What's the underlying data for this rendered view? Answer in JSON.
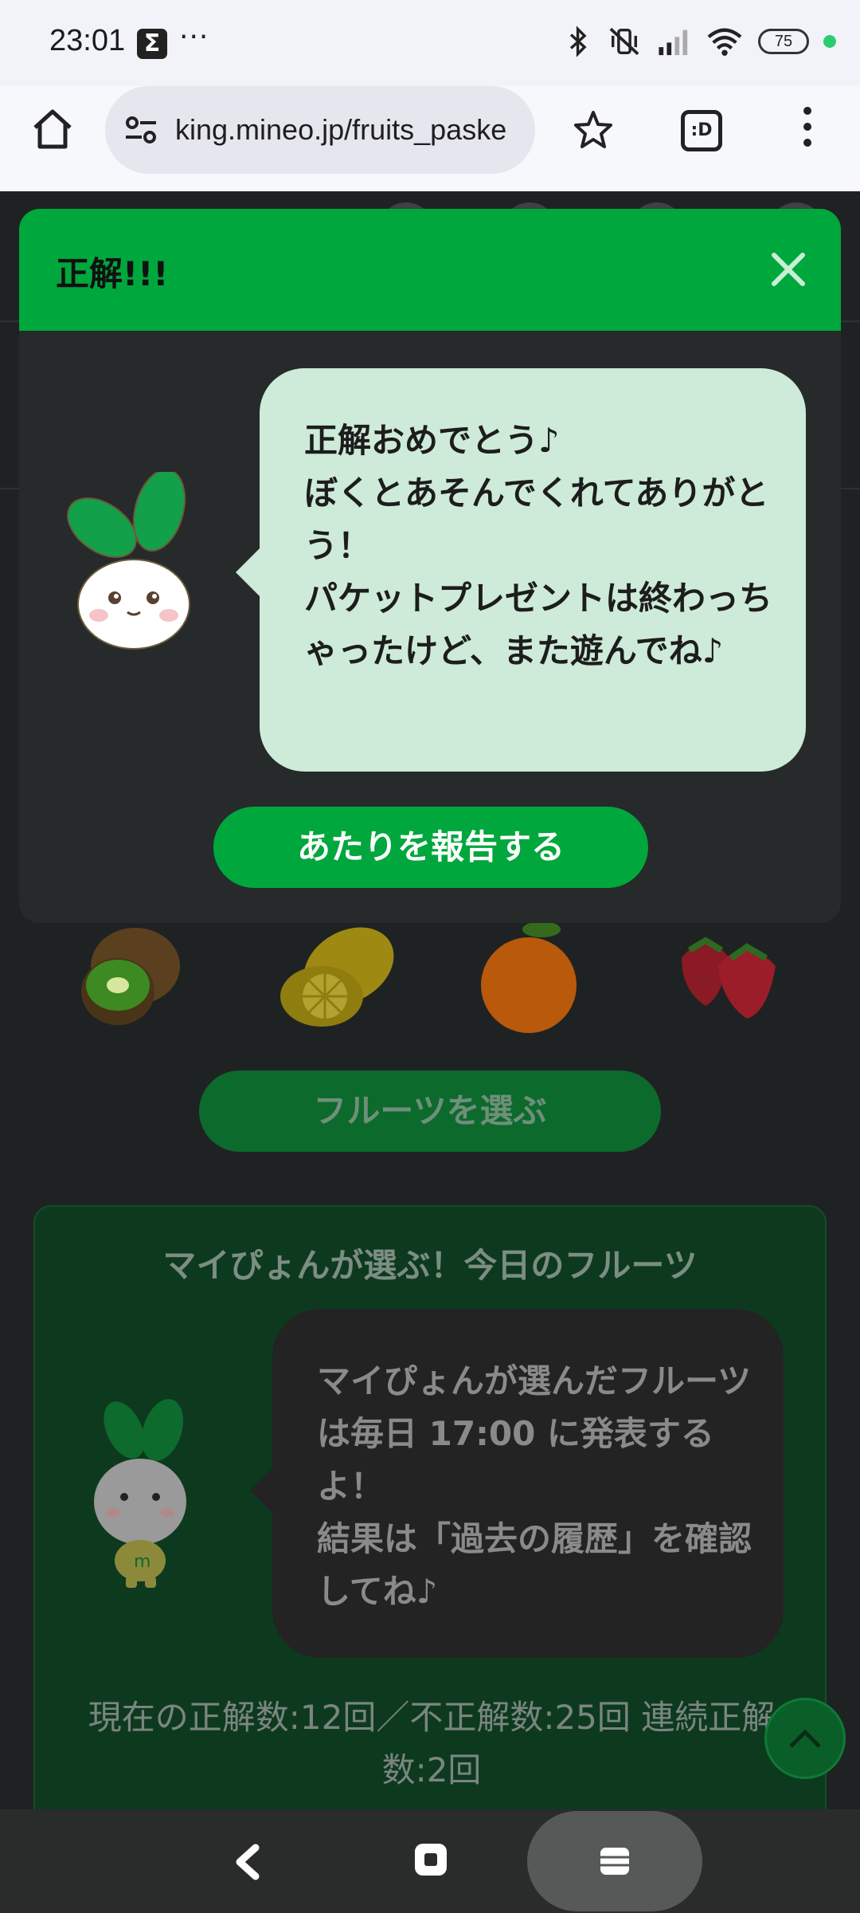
{
  "status_bar": {
    "time": "23:01",
    "notif_icon": "Σ",
    "more_dots": "···",
    "battery": "75"
  },
  "browser": {
    "url": "king.mineo.jp/fruits_paske",
    "tabs_label": ":D"
  },
  "modal": {
    "title": "正解!!!",
    "message": "正解おめでとう♪\nぼくとあそんでくれてありがとう！\nパケットプレゼントは終わっちゃったけど、また遊んでね♪",
    "report_button": "あたりを報告する"
  },
  "page": {
    "choose_button": "フルーツを選ぶ",
    "today_title": "マイぴょんが選ぶ！今日のフルーツ",
    "today_message": "マイぴょんが選んだフルーツは毎日 17:00 に発表するよ！\n結果は「過去の履歴」を確認してね♪",
    "score": "現在の正解数:12回／不正解数:25回 連続正解数:2回",
    "fruits": [
      "kiwi",
      "lemon",
      "orange",
      "strawberry"
    ]
  },
  "colors": {
    "accent_green": "#00a73d",
    "bubble_green": "#cdebd8",
    "modal_bg": "#262a2a"
  }
}
